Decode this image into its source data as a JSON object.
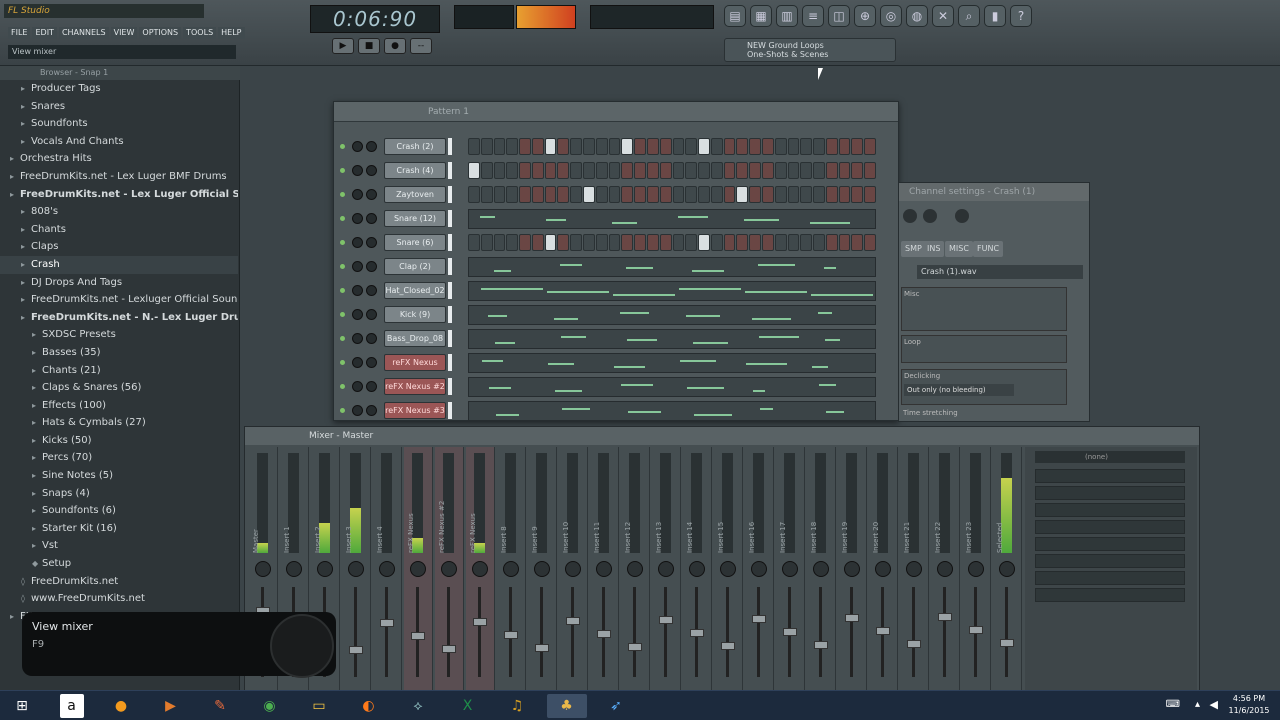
{
  "app": {
    "logo": "FL Studio",
    "menu": [
      "FILE",
      "EDIT",
      "CHANNELS",
      "VIEW",
      "OPTIONS",
      "TOOLS",
      "HELP"
    ],
    "hint": "View mixer",
    "time": "0:06:90",
    "browser_panel_title": "Browser - Snap 1",
    "news_line1": "NEW Ground Loops",
    "news_line2": "One-Shots & Scenes",
    "preset": "(none)"
  },
  "browser": {
    "items": [
      {
        "label": "Producer Tags",
        "icon": "folder-icon",
        "level": 2
      },
      {
        "label": "Snares",
        "icon": "folder-icon",
        "level": 2
      },
      {
        "label": "Soundfonts",
        "icon": "folder-icon",
        "level": 2
      },
      {
        "label": "Vocals And Chants",
        "icon": "folder-icon",
        "level": 2
      },
      {
        "label": "Orchestra Hits",
        "icon": "folder-icon",
        "level": 1
      },
      {
        "label": "FreeDrumKits.net - Lex Luger BMF Drums",
        "icon": "folder-icon",
        "level": 1
      },
      {
        "label": "FreeDrumKits.net - Lex Luger Official Sounds",
        "icon": "folder-icon",
        "level": 1,
        "bold": true
      },
      {
        "label": "808's",
        "icon": "folder-icon",
        "level": 2
      },
      {
        "label": "Chants",
        "icon": "folder-icon",
        "level": 2
      },
      {
        "label": "Claps",
        "icon": "folder-icon",
        "level": 2
      },
      {
        "label": "Crash",
        "icon": "folder-icon",
        "level": 2,
        "selected": true
      },
      {
        "label": "DJ Drops And Tags",
        "icon": "folder-icon",
        "level": 2
      },
      {
        "label": "FreeDrumKits.net - Lexluger Official Sounds",
        "icon": "folder-icon",
        "level": 2
      },
      {
        "label": "FreeDrumKits.net - N.- Lex Luger Drum Kit",
        "icon": "folder-icon",
        "level": 2,
        "bold": true
      },
      {
        "label": "SXDSC Presets",
        "icon": "folder-icon",
        "level": 3
      },
      {
        "label": "Basses (35)",
        "icon": "folder-icon",
        "level": 3
      },
      {
        "label": "Chants (21)",
        "icon": "folder-icon",
        "level": 3
      },
      {
        "label": "Claps & Snares (56)",
        "icon": "folder-icon",
        "level": 3
      },
      {
        "label": "Effects (100)",
        "icon": "folder-icon",
        "level": 3
      },
      {
        "label": "Hats & Cymbals (27)",
        "icon": "folder-icon",
        "level": 3
      },
      {
        "label": "Kicks (50)",
        "icon": "folder-icon",
        "level": 3
      },
      {
        "label": "Percs (70)",
        "icon": "folder-icon",
        "level": 3
      },
      {
        "label": "Sine Notes (5)",
        "icon": "folder-icon",
        "level": 3
      },
      {
        "label": "Snaps (4)",
        "icon": "folder-icon",
        "level": 3
      },
      {
        "label": "Soundfonts (6)",
        "icon": "folder-icon",
        "level": 3
      },
      {
        "label": "Starter Kit (16)",
        "icon": "folder-icon",
        "level": 3
      },
      {
        "label": "Vst",
        "icon": "folder-icon",
        "level": 3
      },
      {
        "label": "Setup",
        "icon": "file-icon",
        "level": 3
      },
      {
        "label": "FreeDrumKits.net",
        "icon": "link-icon",
        "level": 2
      },
      {
        "label": "www.FreeDrumKits.net",
        "icon": "link-icon",
        "level": 2
      },
      {
        "label": "FX",
        "icon": "folder-icon",
        "level": 1
      }
    ]
  },
  "tooltip": {
    "title": "View mixer",
    "shortcut": "F9"
  },
  "sequencer": {
    "title": "Pattern 1",
    "channels": [
      {
        "name": "Crash (2)",
        "type": "steps",
        "red": false,
        "on": [
          7,
          13,
          19
        ]
      },
      {
        "name": "Crash (4)",
        "type": "steps",
        "red": false,
        "on": [
          1
        ]
      },
      {
        "name": "Zaytoven Chant",
        "type": "steps",
        "red": false,
        "on": [
          10,
          22
        ]
      },
      {
        "name": "Snare (12)",
        "type": "roll",
        "red": false
      },
      {
        "name": "Snare (6)",
        "type": "steps",
        "red": false,
        "on": [
          7,
          19
        ]
      },
      {
        "name": "Clap (2)",
        "type": "roll",
        "red": false
      },
      {
        "name": "Hat_Closed_02",
        "type": "roll",
        "red": false
      },
      {
        "name": "Kick (9)",
        "type": "roll",
        "red": false
      },
      {
        "name": "Bass_Drop_08",
        "type": "roll",
        "red": false
      },
      {
        "name": "reFX Nexus",
        "type": "roll",
        "red": true
      },
      {
        "name": "reFX Nexus #2",
        "type": "roll",
        "red": true
      },
      {
        "name": "reFX Nexus #3",
        "type": "roll",
        "red": true
      }
    ]
  },
  "channel_settings": {
    "title": "Channel settings - Crash (1)",
    "tabs": [
      "SMP",
      "INS",
      "MISC",
      "FUNC"
    ],
    "sample": "Crash (1).wav",
    "sections": [
      "Misc",
      "Loop",
      "Declicking",
      "Time stretching"
    ],
    "declick_value": "Out only (no bleeding)"
  },
  "mixer": {
    "title": "Mixer - Master",
    "tracks": [
      "Master",
      "Insert 1",
      "Insert 2",
      "Insert 3",
      "Insert 4",
      "reFX Nexus",
      "reFX Nexus #2",
      "reFX Nexus",
      "Insert 8",
      "Insert 9",
      "Insert 10",
      "Insert 11",
      "Insert 12",
      "Insert 13",
      "Insert 14",
      "Insert 15",
      "Insert 16",
      "Insert 17",
      "Insert 18",
      "Insert 19",
      "Insert 20",
      "Insert 21",
      "Insert 22",
      "Insert 23",
      "Selected"
    ],
    "levels": [
      0.1,
      0,
      0.3,
      0.45,
      0,
      0.15,
      0,
      0.1,
      0,
      0,
      0,
      0,
      0,
      0,
      0,
      0,
      0,
      0,
      0,
      0,
      0,
      0,
      0,
      0,
      0.75
    ],
    "insert_label": "(none)"
  },
  "taskbar": {
    "apps": [
      "windows-icon",
      "amazon-icon",
      "orange-icon",
      "media-icon",
      "paint-icon",
      "chrome-icon",
      "folder-icon",
      "firefox-icon",
      "app-icon",
      "excel-icon",
      "headphones-icon",
      "fl-studio-icon",
      "app2-icon"
    ],
    "time": "4:56 PM",
    "date": "11/6/2015"
  }
}
